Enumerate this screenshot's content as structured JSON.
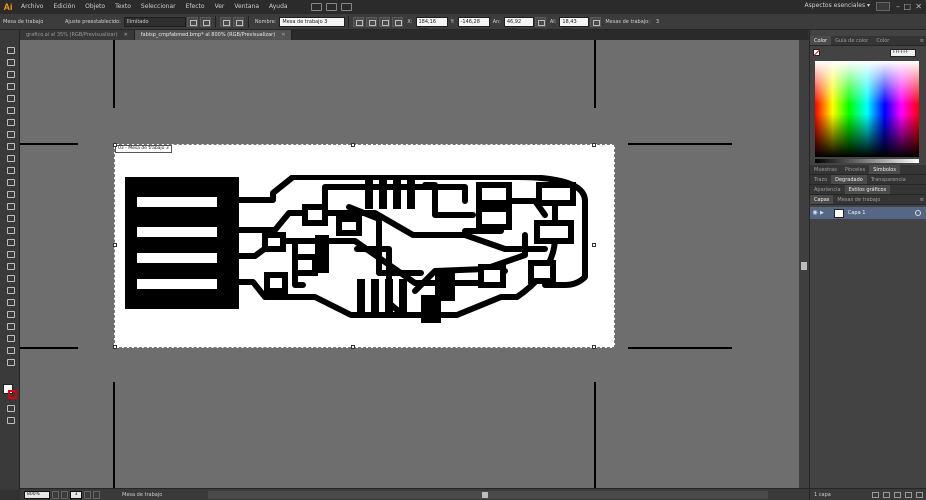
{
  "app": {
    "logo": "Ai",
    "workspace": "Aspectos esenciales"
  },
  "menu": [
    "Archivo",
    "Edición",
    "Objeto",
    "Texto",
    "Seleccionar",
    "Efecto",
    "Ver",
    "Ventana",
    "Ayuda"
  ],
  "window": {
    "minimize": "–",
    "maximize": "□",
    "close": "✕"
  },
  "control_bar": {
    "mode_label": "Mesa de trabajo",
    "preset_label": "Ajuste preestablecido:",
    "preset_value": "Ilimitado",
    "name_label": "Nombre:",
    "name_value": "Mesa de trabajo 3",
    "x_label": "X:",
    "x_value": "184,16 mm",
    "y_label": "Y:",
    "y_value": "-146,28 mm",
    "w_label": "An:",
    "w_value": "46,92 mm",
    "h_label": "Al:",
    "h_value": "18,43 mm",
    "artboards_label": "Mesas de trabajo:",
    "artboards_value": "3"
  },
  "tabs": [
    {
      "label": "grafico.ai al 35% (RGB/Previsualizar)",
      "active": false
    },
    {
      "label": "fabisp_cmpfabmed.bmp* al 800% (RGB/Previsualizar)",
      "active": true
    }
  ],
  "artboard": {
    "label": "03 - Mesa de trabajo 3"
  },
  "status_bar": {
    "zoom": "800%",
    "page": "3",
    "label": "Mesa de trabajo"
  },
  "panels": {
    "color_tabs": [
      "Color",
      "Guía de color",
      "Color"
    ],
    "hex_value": "FFFFFF",
    "swatch_tabs": [
      "Muestras",
      "Pinceles",
      "Símbolos"
    ],
    "stroke_tabs": [
      "Trazo",
      "Degradado",
      "Transparencia"
    ],
    "appearance_tabs": [
      "Apariencia",
      "Estilos gráficos"
    ],
    "layer_tabs": [
      "Capas",
      "Mesas de trabajo"
    ],
    "layers": [
      {
        "name": "Capa 1"
      }
    ],
    "layers_count": "1 capa"
  },
  "colors": {
    "canvas": "#6e6e6e",
    "panel": "#434343",
    "selection": "#566786",
    "accent": "#ff9a00"
  },
  "icons": [
    "selection-tool-icon",
    "direct-selection-tool-icon",
    "magic-wand-icon",
    "lasso-icon",
    "pen-tool-icon",
    "type-tool-icon",
    "line-tool-icon",
    "rectangle-tool-icon",
    "paintbrush-icon",
    "pencil-icon",
    "blob-brush-icon",
    "eraser-icon",
    "rotate-icon",
    "scale-icon",
    "warp-icon",
    "free-transform-icon",
    "symbol-sprayer-icon",
    "graph-icon",
    "mesh-icon",
    "gradient-icon",
    "eyedropper-icon",
    "blend-icon",
    "live-paint-icon",
    "artboard-tool-icon",
    "slice-icon",
    "hand-tool-icon",
    "zoom-tool-icon",
    "eye-icon",
    "search-icon"
  ]
}
